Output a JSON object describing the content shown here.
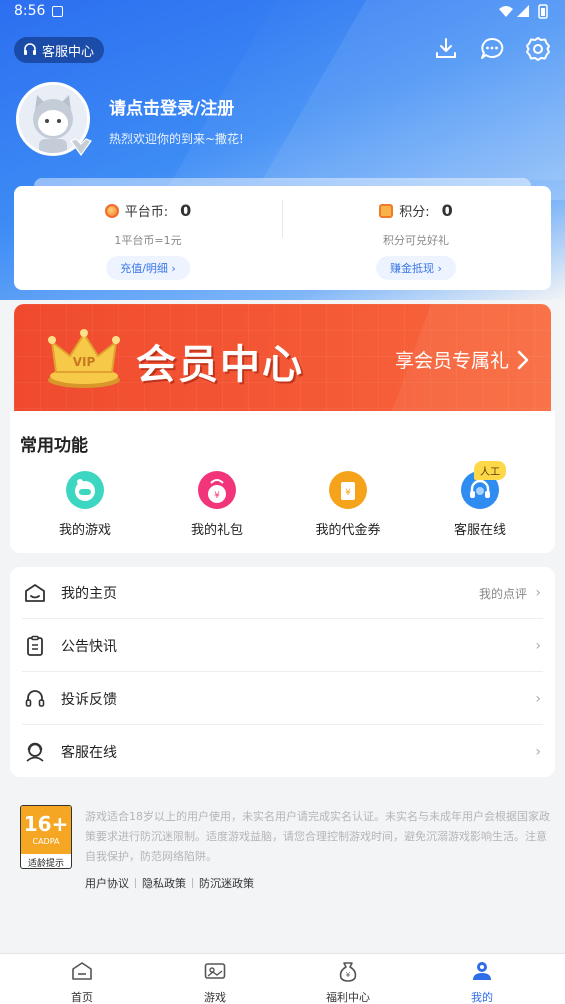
{
  "status_bar": {
    "time": "8:56"
  },
  "header": {
    "customer_service_label": "客服中心",
    "icons": [
      "download-icon",
      "message-icon",
      "settings-icon"
    ]
  },
  "user": {
    "login_prompt": "请点击登录/注册",
    "welcome": "热烈欢迎你的到来~撒花!"
  },
  "wallet": {
    "coin_label": "平台币:",
    "coin_value": "0",
    "coin_rate": "1平台币=1元",
    "coin_button": "充值/明细 ›",
    "points_label": "积分:",
    "points_value": "0",
    "points_note": "积分可兑好礼",
    "points_button": "赚金抵现 ›"
  },
  "vip_banner": {
    "title": "会员中心",
    "subtitle": "享会员专属礼",
    "colors": {
      "background": "#f04a2e",
      "crown": "#f7c948"
    }
  },
  "functions": {
    "title": "常用功能",
    "badge": "人工",
    "items": [
      {
        "label": "我的游戏",
        "icon": "gamepad-icon",
        "color": "#3dd6c0"
      },
      {
        "label": "我的礼包",
        "icon": "gift-icon",
        "color": "#f2357a"
      },
      {
        "label": "我的代金券",
        "icon": "voucher-icon",
        "color": "#f5a31a"
      },
      {
        "label": "客服在线",
        "icon": "headset-icon",
        "color": "#2f8cf0"
      }
    ]
  },
  "menu": [
    {
      "label": "我的主页",
      "right": "我的点评",
      "icon": "home-icon"
    },
    {
      "label": "公告快讯",
      "right": "",
      "icon": "clipboard-icon"
    },
    {
      "label": "投诉反馈",
      "right": "",
      "icon": "headphones-icon"
    },
    {
      "label": "客服在线",
      "right": "",
      "icon": "agent-icon"
    }
  ],
  "footer": {
    "age_rating": "16+",
    "age_org": "CADPA",
    "age_caption": "适龄提示",
    "notice": "游戏适合18岁以上的用户使用，未实名用户请完成实名认证。未实名与未成年用户会根据国家政策要求进行防沉迷限制。适度游戏益脑，请您合理控制游戏时间，避免沉溺游戏影响生活。注意自我保护，防范网络陷阱。",
    "links": [
      "用户协议",
      "隐私政策",
      "防沉迷政策"
    ]
  },
  "tabs": [
    {
      "label": "首页",
      "icon": "home-tab-icon"
    },
    {
      "label": "游戏",
      "icon": "games-tab-icon"
    },
    {
      "label": "福利中心",
      "icon": "welfare-tab-icon"
    },
    {
      "label": "我的",
      "icon": "profile-tab-icon",
      "active": true
    }
  ],
  "colors": {
    "primary": "#2f6ee8",
    "accent_blue": "#3a78e8"
  }
}
